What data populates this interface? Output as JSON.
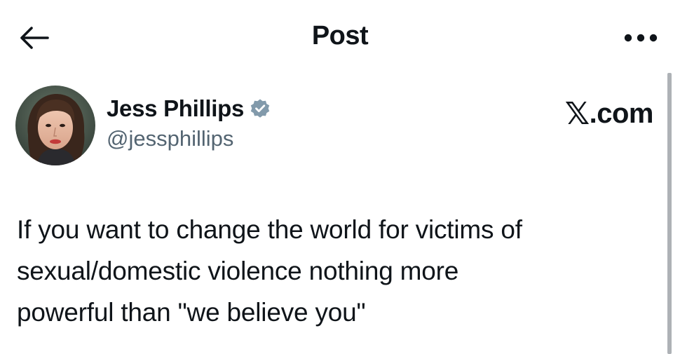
{
  "header": {
    "title": "Post",
    "back_icon": "arrow-left-icon",
    "more_icon": "more-horizontal-icon"
  },
  "author": {
    "display_name": "Jess Phillips",
    "handle": "@jessphillips",
    "verified": true,
    "verified_badge_color": "#829aab",
    "avatar_icon": "avatar-photo"
  },
  "brand": {
    "x_glyph": "𝕏",
    "suffix": ".com"
  },
  "tweet": {
    "line1": "If you want to change the world for victims of",
    "line2": "sexual/domestic violence nothing more",
    "line3": "powerful than \"we believe you\""
  },
  "colors": {
    "text_primary": "#0f1419",
    "text_secondary": "#536471",
    "background": "#ffffff"
  }
}
